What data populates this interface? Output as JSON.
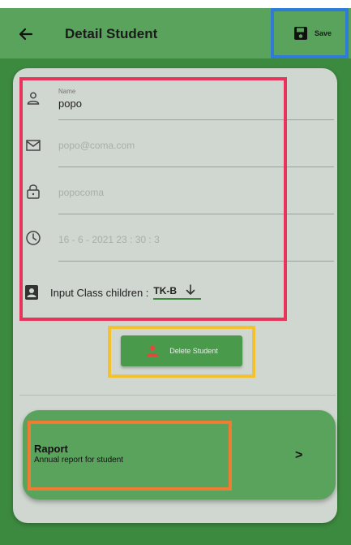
{
  "appbar": {
    "title": "Detail Student",
    "save_label": "Save",
    "back_icon": "arrow-left-icon",
    "save_icon": "floppy-disk-icon"
  },
  "form": {
    "name": {
      "label": "Name",
      "value": "popo",
      "icon": "person-icon"
    },
    "email": {
      "value": "popo@coma.com",
      "icon": "envelope-icon"
    },
    "password": {
      "value": "popocoma",
      "icon": "lock-icon"
    },
    "datetime": {
      "value": "16 - 6 - 2021 23 : 30 : 3",
      "icon": "clock-icon"
    },
    "class": {
      "label": "Input Class children :",
      "value": "TK-B",
      "icon": "id-badge-icon"
    }
  },
  "delete_button": {
    "label": "Delete Student",
    "icon": "person-remove-icon"
  },
  "report": {
    "title": "Raport",
    "subtitle": "Annual report for student",
    "chevron": ">"
  },
  "colors": {
    "primary": "#5aa35c",
    "background": "#3c8a3f",
    "card": "#d0d6d0"
  }
}
